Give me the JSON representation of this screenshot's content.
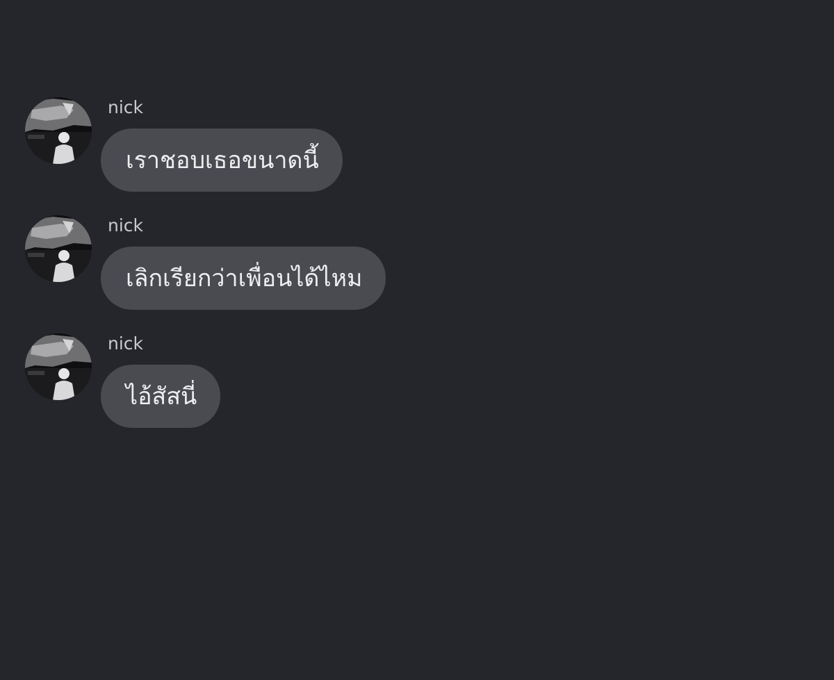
{
  "conversation": {
    "messages": [
      {
        "sender": "nick",
        "text": "เราชอบเธอขนาดนี้"
      },
      {
        "sender": "nick",
        "text": "เลิกเรียกว่าเพื่อนได้ไหม"
      },
      {
        "sender": "nick",
        "text": "ไอ้สัสนี่"
      }
    ]
  },
  "colors": {
    "background": "#25262b",
    "bubble": "#4a4b51",
    "sender_text": "#c9cacf",
    "bubble_text": "#eeeef0"
  },
  "icons": {
    "avatar": "user-avatar-photo"
  }
}
